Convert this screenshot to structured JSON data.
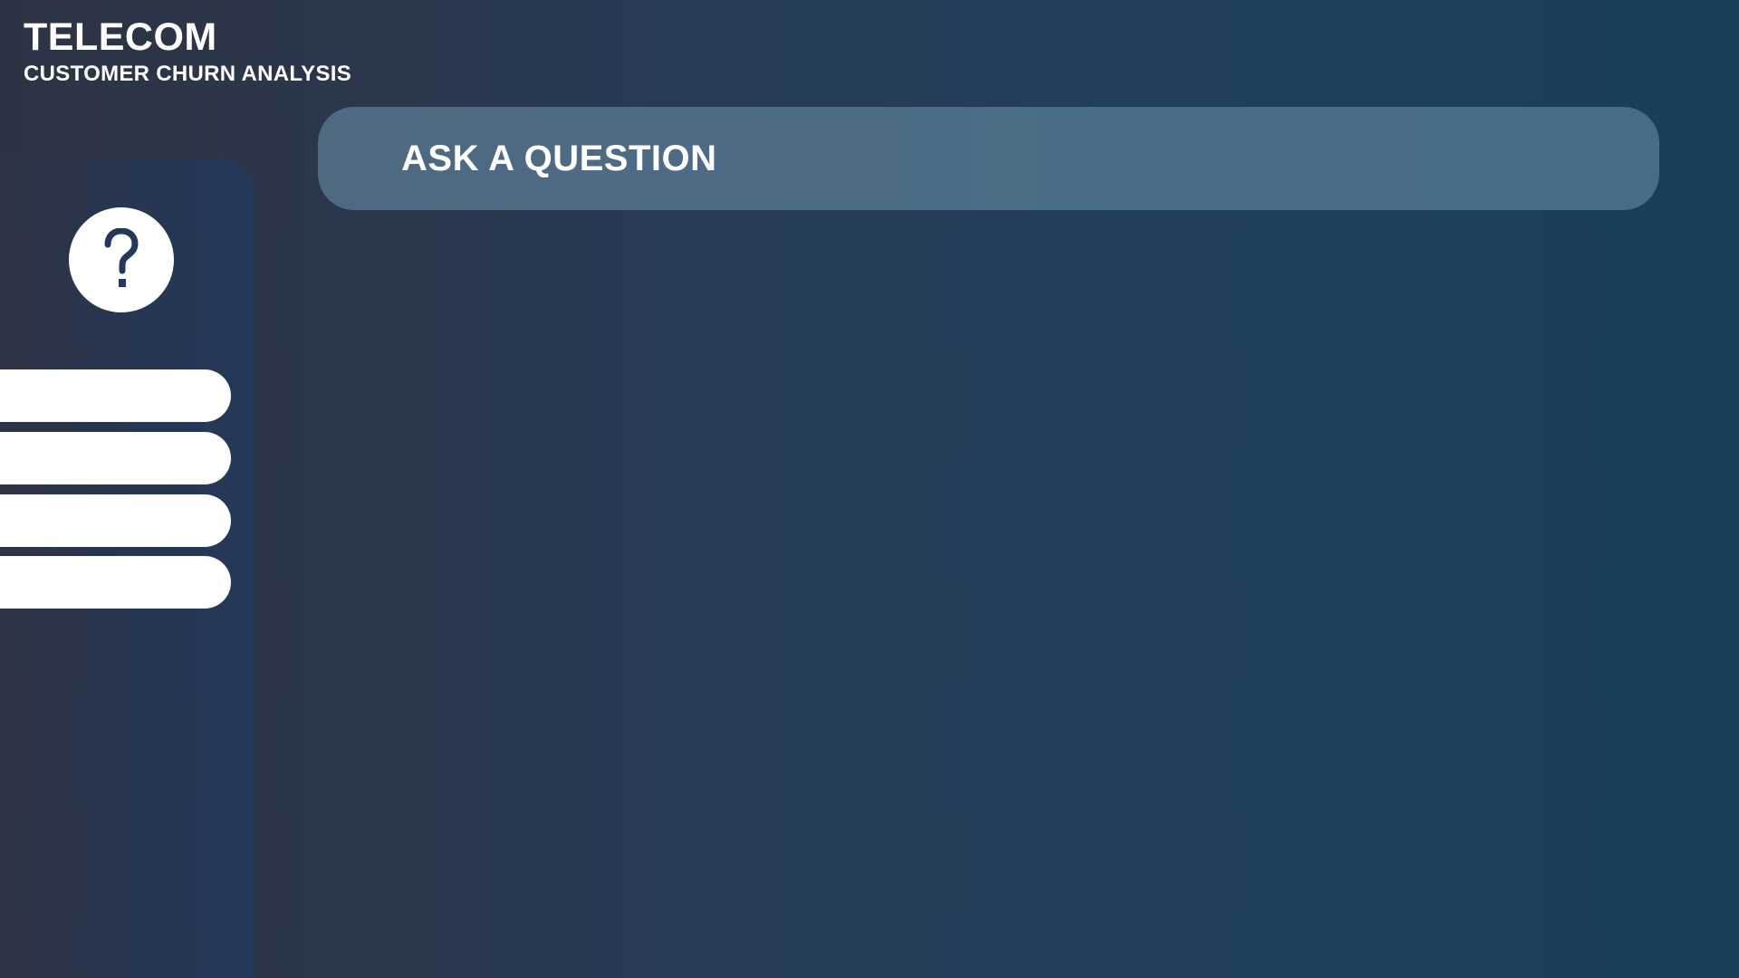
{
  "header": {
    "title": "TELECOM",
    "subtitle": "CUSTOMER CHURN ANALYSIS"
  },
  "sidebar": {
    "help_icon": "question-mark-icon",
    "nav_items": [
      {
        "label": ""
      },
      {
        "label": ""
      },
      {
        "label": ""
      },
      {
        "label": ""
      }
    ]
  },
  "qa": {
    "placeholder": "ASK A QUESTION"
  },
  "colors": {
    "background_left": "#2d3344",
    "background_right": "#193f58",
    "question_bar": "#44637a",
    "icon_dark": "#24385a",
    "white": "#ffffff"
  }
}
